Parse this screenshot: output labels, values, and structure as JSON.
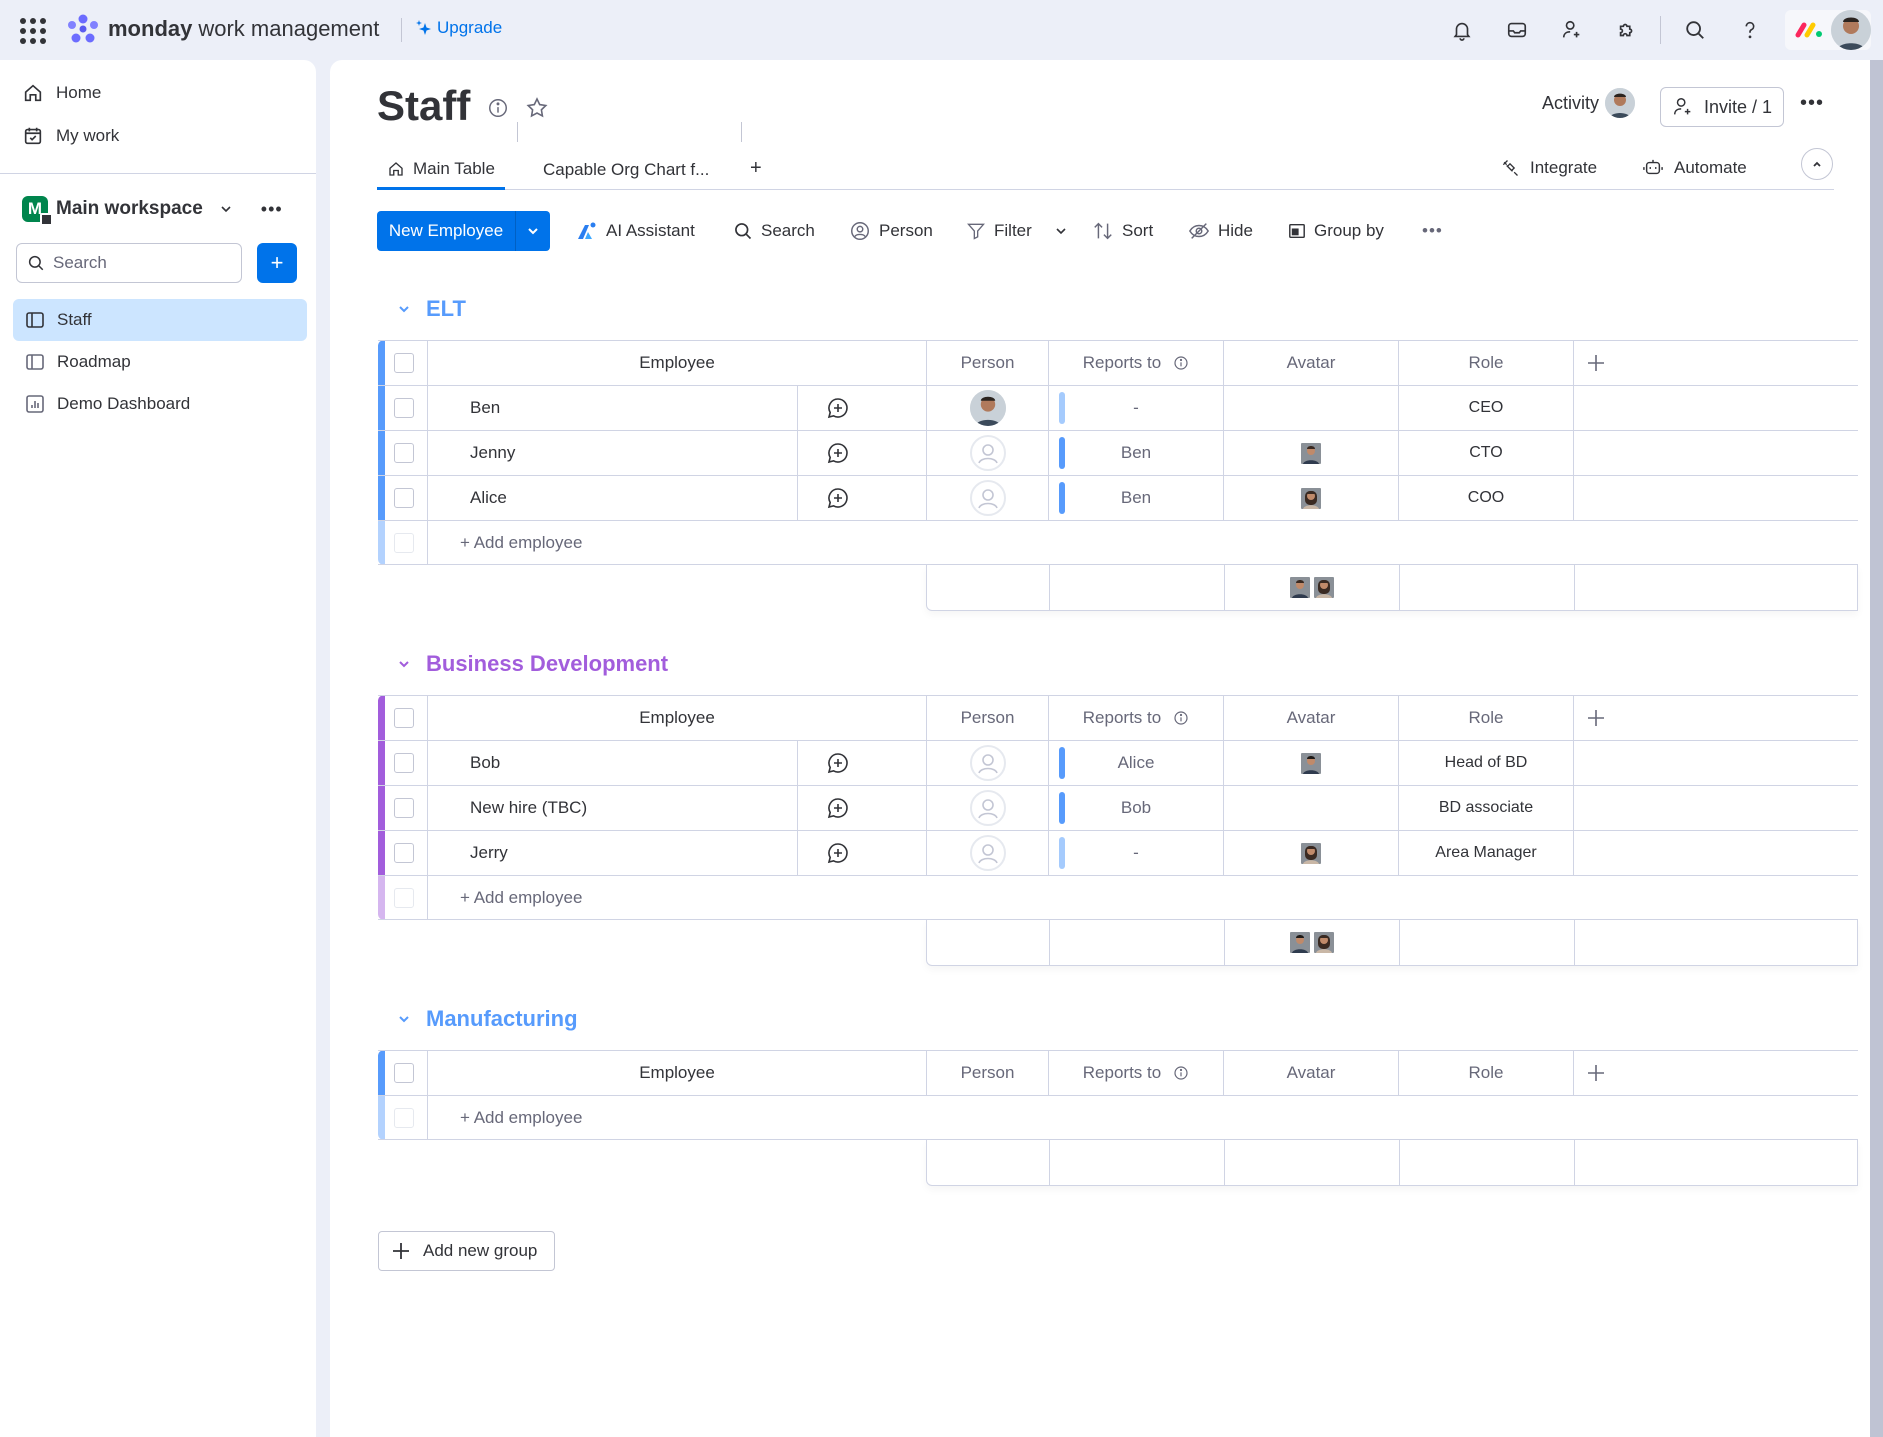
{
  "topbar": {
    "brand": "monday",
    "product": "work management",
    "upgrade_label": "Upgrade",
    "icons": [
      "bell-icon",
      "inbox-icon",
      "invite-user-icon",
      "apps-puzzle-icon",
      "search-icon",
      "help-icon"
    ]
  },
  "sidebar": {
    "nav": [
      {
        "label": "Home",
        "icon": "home-icon"
      },
      {
        "label": "My work",
        "icon": "calendar-check-icon"
      }
    ],
    "workspace": {
      "initial": "M",
      "name": "Main workspace"
    },
    "search_placeholder": "Search",
    "add_label": "+",
    "boards": [
      {
        "label": "Staff",
        "icon": "board-icon",
        "active": true
      },
      {
        "label": "Roadmap",
        "icon": "board-icon",
        "active": false
      },
      {
        "label": "Demo Dashboard",
        "icon": "dashboard-icon",
        "active": false
      }
    ]
  },
  "board": {
    "title": "Staff",
    "activity_label": "Activity",
    "invite_label": "Invite / 1",
    "tabs": [
      {
        "label": "Main Table",
        "active": true
      },
      {
        "label": "Capable Org Chart f...",
        "active": false
      }
    ],
    "tab_add": "+",
    "integrate_label": "Integrate",
    "automate_label": "Automate"
  },
  "toolbar": {
    "new_item_label": "New Employee",
    "ai_label": "AI Assistant",
    "search_label": "Search",
    "person_label": "Person",
    "filter_label": "Filter",
    "sort_label": "Sort",
    "hide_label": "Hide",
    "group_by_label": "Group by"
  },
  "columns": {
    "employee": "Employee",
    "person": "Person",
    "reports_to": "Reports to",
    "avatar": "Avatar",
    "role": "Role"
  },
  "add_item_label": "+ Add employee",
  "add_group_label": "Add new group",
  "colors": {
    "primary": "#0073ea",
    "elt": "#579bfc",
    "bd": "#a25ddc",
    "manufacturing": "#579bfc"
  },
  "groups": [
    {
      "name": "ELT",
      "color": "#579bfc",
      "rows": [
        {
          "name": "Ben",
          "person": "photo",
          "reports_to": "-",
          "avatar": false,
          "role": "CEO"
        },
        {
          "name": "Jenny",
          "person": "empty",
          "reports_to": "Ben",
          "avatar": "woman-short-hair",
          "role": "CTO"
        },
        {
          "name": "Alice",
          "person": "empty",
          "reports_to": "Ben",
          "avatar": "woman-long-hair",
          "role": "COO"
        }
      ],
      "summary_avatars": [
        "woman-short-hair",
        "woman-long-hair"
      ]
    },
    {
      "name": "Business Development",
      "color": "#a25ddc",
      "rows": [
        {
          "name": "Bob",
          "person": "empty",
          "reports_to": "Alice",
          "avatar": "man-suit",
          "role": "Head of BD"
        },
        {
          "name": "New hire (TBC)",
          "person": "empty",
          "reports_to": "Bob",
          "avatar": false,
          "role": "BD associate"
        },
        {
          "name": "Jerry",
          "person": "empty",
          "reports_to": "-",
          "avatar": "woman-long-hair",
          "role": "Area Manager"
        }
      ],
      "summary_avatars": [
        "man-suit",
        "woman-long-hair"
      ]
    },
    {
      "name": "Manufacturing",
      "color": "#579bfc",
      "rows": [],
      "summary_avatars": []
    }
  ]
}
